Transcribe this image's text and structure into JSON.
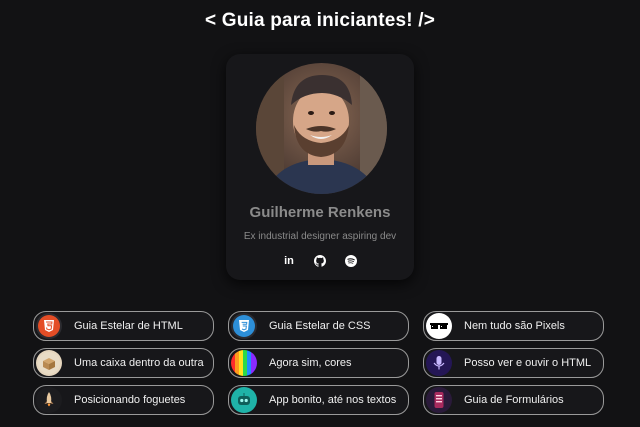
{
  "header": {
    "title": "< Guia para iniciantes! />"
  },
  "profile": {
    "name": "Guilherme Renkens",
    "bio": "Ex industrial designer aspiring dev",
    "socials": [
      {
        "icon": "linkedin-icon",
        "label": "in"
      },
      {
        "icon": "github-icon"
      },
      {
        "icon": "spotify-icon"
      }
    ]
  },
  "links": [
    {
      "label": "Guia Estelar de HTML",
      "icon": "html5-icon",
      "color": "#e44d26"
    },
    {
      "label": "Guia Estelar de CSS",
      "icon": "css3-icon",
      "color": "#2d8fd8"
    },
    {
      "label": "Nem tudo são Pixels",
      "icon": "pixel-sunglasses-icon",
      "color": "#ffffff"
    },
    {
      "label": "Uma caixa dentro da outra",
      "icon": "box-icon",
      "color": "#c9a67a"
    },
    {
      "label": "Agora sim, cores",
      "icon": "rainbow-icon",
      "color": "#7b2cff"
    },
    {
      "label": "Posso ver e ouvir o HTML",
      "icon": "microphone-icon",
      "color": "#2a1a6e"
    },
    {
      "label": "Posicionando foguetes",
      "icon": "rocket-icon",
      "color": "#e8c9a0"
    },
    {
      "label": "App bonito, até nos textos",
      "icon": "robot-icon",
      "color": "#1fb3a8"
    },
    {
      "label": "Guia de Formulários",
      "icon": "phone-form-icon",
      "color": "#a82a5e"
    }
  ]
}
